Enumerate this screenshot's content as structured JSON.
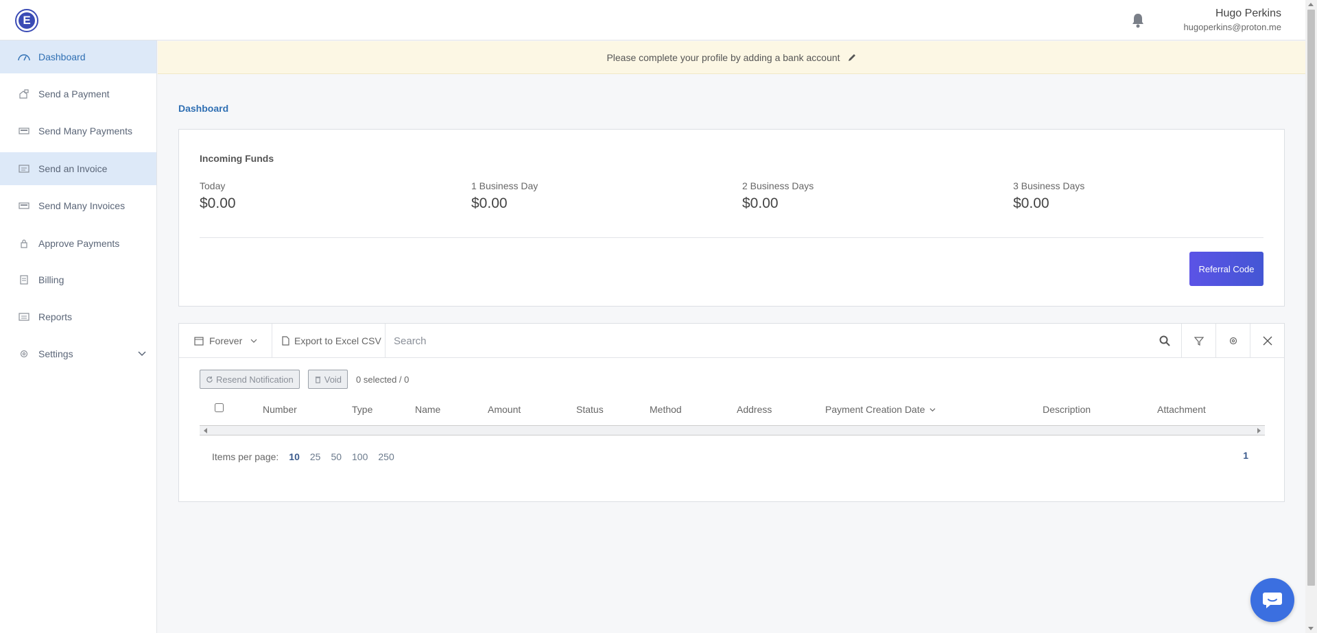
{
  "header": {
    "logo_letter": "E",
    "user_name": "Hugo Perkins",
    "user_email": "hugoperkins@proton.me"
  },
  "sidebar": {
    "items": [
      {
        "label": "Dashboard",
        "icon": "dashboard-icon",
        "state": "active"
      },
      {
        "label": "Send a Payment",
        "icon": "send-payment-icon",
        "state": "normal"
      },
      {
        "label": "Send Many Payments",
        "icon": "send-many-payments-icon",
        "state": "normal"
      },
      {
        "label": "Send an Invoice",
        "icon": "invoice-icon",
        "state": "hover"
      },
      {
        "label": "Send Many Invoices",
        "icon": "send-many-invoices-icon",
        "state": "normal"
      },
      {
        "label": "Approve Payments",
        "icon": "lock-icon",
        "state": "normal"
      },
      {
        "label": "Billing",
        "icon": "billing-icon",
        "state": "normal"
      },
      {
        "label": "Reports",
        "icon": "reports-icon",
        "state": "normal"
      },
      {
        "label": "Settings",
        "icon": "gear-icon",
        "state": "normal"
      }
    ]
  },
  "banner": {
    "text": "Please complete your profile by adding a bank account"
  },
  "breadcrumb": "Dashboard",
  "incoming_funds": {
    "title": "Incoming Funds",
    "items": [
      {
        "label": "Today",
        "value": "$0.00"
      },
      {
        "label": "1 Business Day",
        "value": "$0.00"
      },
      {
        "label": "2 Business Days",
        "value": "$0.00"
      },
      {
        "label": "3 Business Days",
        "value": "$0.00"
      }
    ],
    "referral_label": "Referral Code"
  },
  "table": {
    "period_label": "Forever",
    "export_label": "Export to Excel CSV",
    "search_placeholder": "Search",
    "resend_label": "Resend Notification",
    "void_label": "Void",
    "selected_text": "0 selected / 0",
    "columns": [
      "Number",
      "Type",
      "Name",
      "Amount",
      "Status",
      "Method",
      "Address",
      "Payment Creation Date",
      "Description",
      "Attachment"
    ],
    "items_per_page_label": "Items per page:",
    "page_sizes": [
      "10",
      "25",
      "50",
      "100",
      "250"
    ],
    "active_page_size": "10",
    "current_page": "1"
  },
  "colors": {
    "accent": "#2f6fb3",
    "sidebar_active_bg": "#dde9f8",
    "banner_bg": "#fcf7e4",
    "referral_button": "#4f55dd",
    "chat_bubble": "#3b6fe0"
  }
}
